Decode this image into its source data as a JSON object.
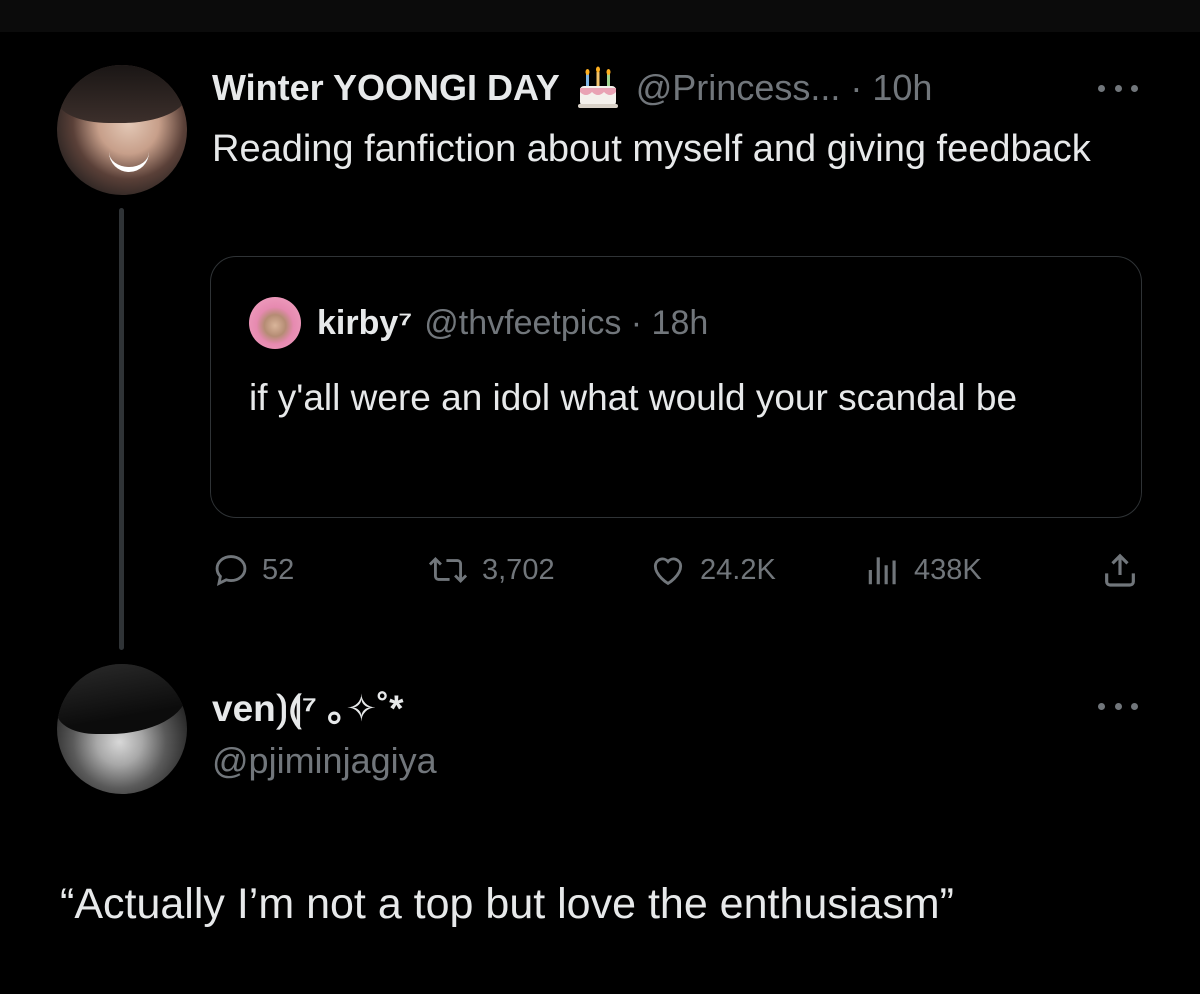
{
  "tweet": {
    "display_name": "Winter YOONGI DAY",
    "emoji": "cake-icon",
    "handle_time": "@Princess... · 10h",
    "text": "Reading fanfiction about myself and giving feedback",
    "quote": {
      "name": "kirby⁷",
      "handle_time": "@thvfeetpics · 18h",
      "text": "if y'all were an idol what would your scandal be"
    },
    "actions": {
      "replies": "52",
      "retweets": "3,702",
      "likes": "24.2K",
      "views": "438K"
    }
  },
  "reply": {
    "display_name": "ven⟯⟬⁷ ｡✧˚*",
    "handle": "@pjiminjagiya"
  },
  "caption": "“Actually I’m not a top but love the enthusiasm”",
  "colors": {
    "background": "#000000",
    "text": "#e7e9ea",
    "secondary": "#71767b",
    "border": "#2f3336"
  }
}
